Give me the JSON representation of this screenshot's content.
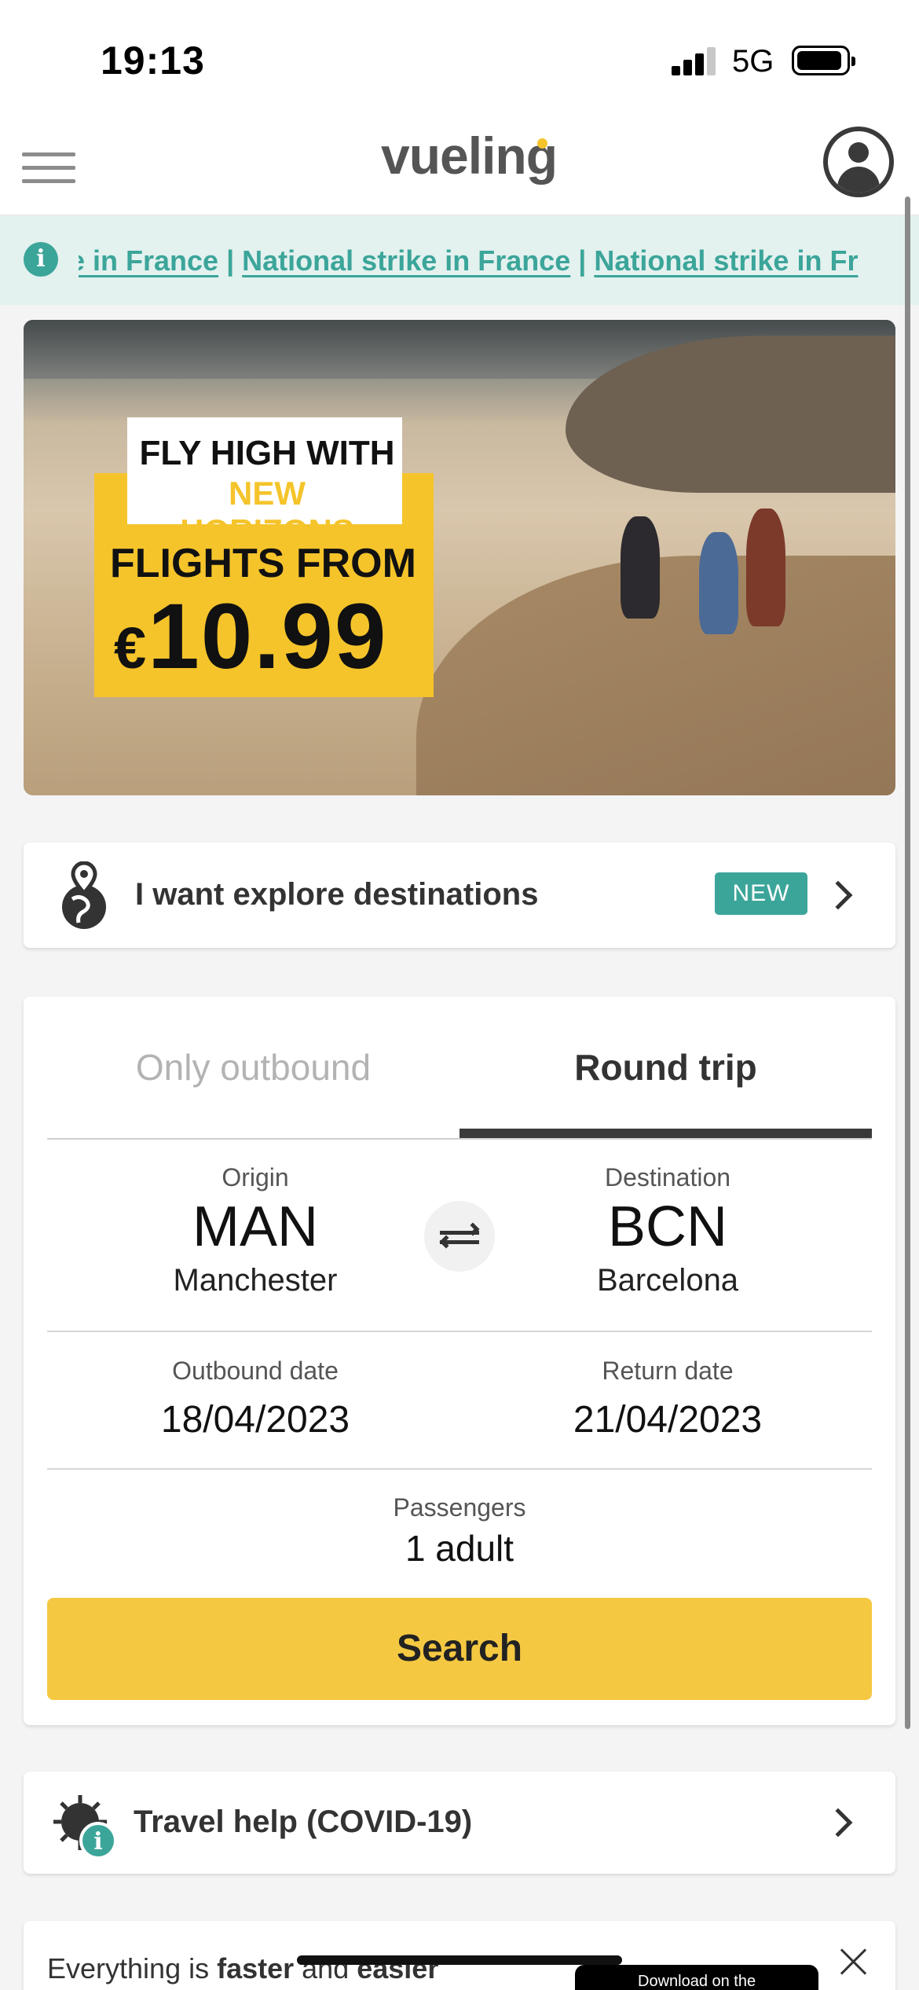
{
  "status_bar": {
    "time": "19:13",
    "network": "5G"
  },
  "header": {
    "logo": "vueling"
  },
  "alert": {
    "items": [
      "e in France",
      "National strike in France",
      "National strike in Fr"
    ],
    "separator": "|"
  },
  "banner": {
    "line1": "FLY HIGH WITH",
    "line2": "NEW HORIZONS",
    "line3": "FLIGHTS FROM",
    "currency": "€",
    "price": "10.99"
  },
  "explore": {
    "label": "I want explore destinations",
    "badge": "NEW"
  },
  "search": {
    "tabs": [
      {
        "label": "Only outbound",
        "active": false
      },
      {
        "label": "Round trip",
        "active": true
      }
    ],
    "origin": {
      "label": "Origin",
      "code": "MAN",
      "city": "Manchester"
    },
    "destination": {
      "label": "Destination",
      "code": "BCN",
      "city": "Barcelona"
    },
    "outbound_date": {
      "label": "Outbound date",
      "value": "18/04/2023"
    },
    "return_date": {
      "label": "Return date",
      "value": "21/04/2023"
    },
    "passengers": {
      "label": "Passengers",
      "value": "1 adult"
    },
    "button": "Search"
  },
  "travel_help": {
    "label": "Travel help (COVID-19)"
  },
  "app_banner": {
    "text_pre": "Everything is ",
    "text_bold1": "faster",
    "text_mid": " and ",
    "text_bold2": "easier",
    "store_label": "Download on the"
  },
  "colors": {
    "accent_teal": "#3ca59a",
    "brand_yellow": "#f5c42b"
  }
}
